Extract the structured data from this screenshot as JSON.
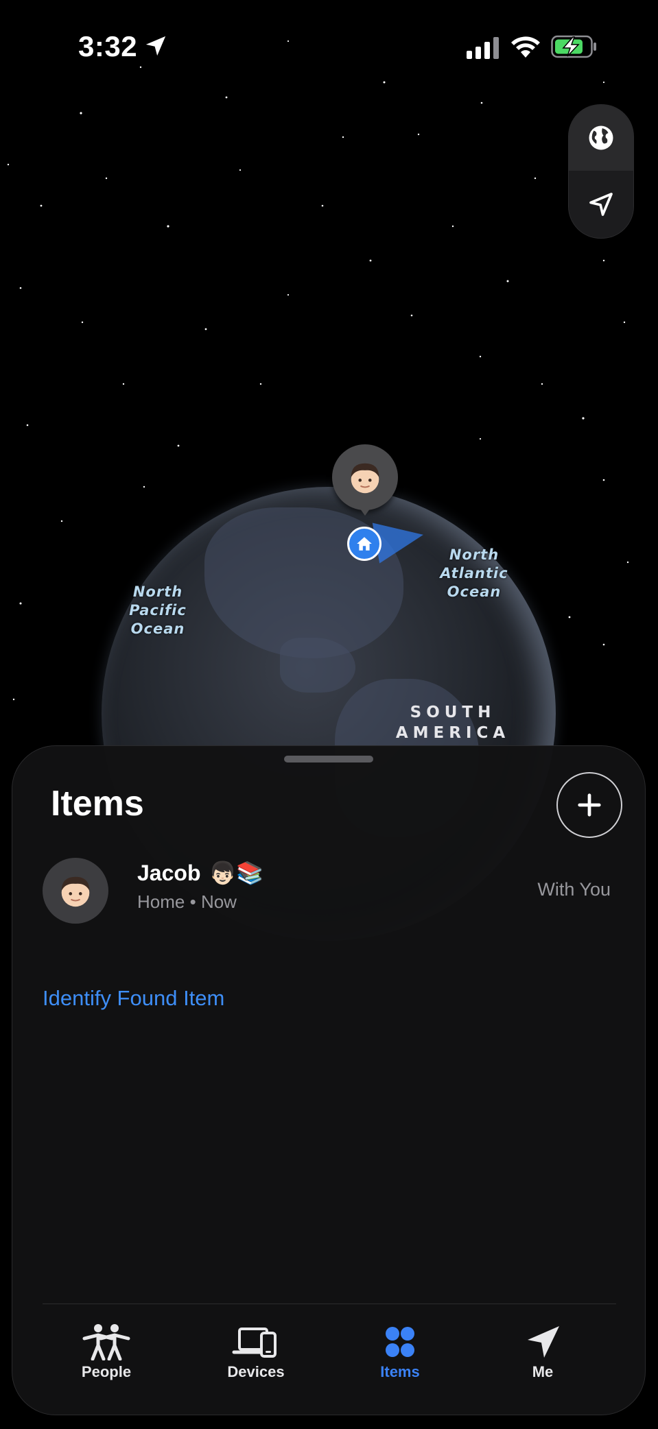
{
  "status_bar": {
    "time": "3:32",
    "location_icon": "location-arrow-icon",
    "signal_icon": "cellular-signal-icon",
    "wifi_icon": "wifi-icon",
    "battery_icon": "battery-charging-icon",
    "battery_color": "#4cd964"
  },
  "map": {
    "controls": [
      {
        "name": "globe-view",
        "icon": "globe-icon"
      },
      {
        "name": "current-location",
        "icon": "location-arrow-icon"
      }
    ],
    "labels": {
      "north_pacific": [
        "North",
        "Pacific",
        "Ocean"
      ],
      "north_atlantic": [
        "North",
        "Atlantic",
        "Ocean"
      ],
      "south_america": [
        "SOUTH",
        "AMERICA"
      ]
    },
    "person_pin_icon": "memoji-icon",
    "home_pin_icon": "home-icon",
    "home_pin_color": "#2f80ed"
  },
  "sheet": {
    "title": "Items",
    "add_icon": "plus-icon",
    "items": [
      {
        "name": "Jacob",
        "emoji": "👦🏻📚",
        "location": "Home",
        "separator": "•",
        "time": "Now",
        "status": "With You",
        "icon": "memoji-icon"
      }
    ],
    "identify_link": "Identify Found Item",
    "link_color": "#3e8ef7"
  },
  "tabs": [
    {
      "label": "People",
      "icon": "people-icon",
      "active": false
    },
    {
      "label": "Devices",
      "icon": "devices-icon",
      "active": false
    },
    {
      "label": "Items",
      "icon": "items-icon",
      "active": true
    },
    {
      "label": "Me",
      "icon": "location-arrow-icon",
      "active": false
    }
  ],
  "accent_color": "#3b82f6"
}
